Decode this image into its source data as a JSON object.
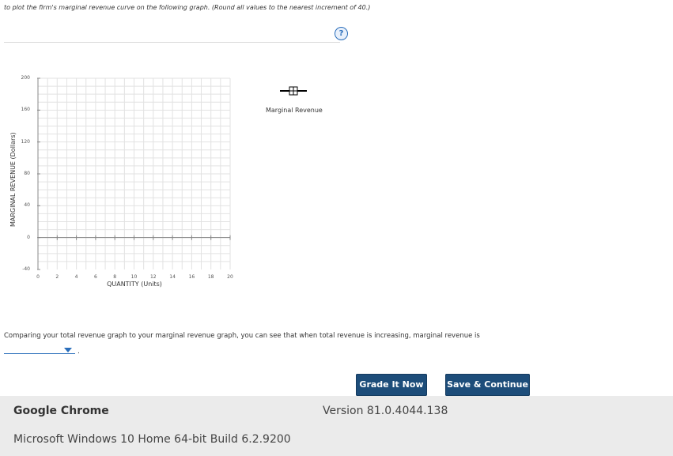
{
  "question": {
    "instruction": "to plot the firm's marginal revenue curve on the following graph. (Round all values to the nearest increment of 40.)",
    "help_label": "?",
    "prompt": "Comparing your total revenue graph to your marginal revenue graph, you can see that when total revenue is increasing, marginal revenue is",
    "dropdown_value": "",
    "period": "."
  },
  "chart_data": {
    "type": "line",
    "ylabel": "MARGINAL REVENUE (Dollars)",
    "xlabel": "QUANTITY (Units)",
    "xlim": [
      0,
      20
    ],
    "ylim": [
      -40,
      200
    ],
    "xticks": [
      0,
      2,
      4,
      6,
      8,
      10,
      12,
      14,
      16,
      18,
      20
    ],
    "yticks": [
      -40,
      0,
      40,
      80,
      120,
      160,
      200
    ],
    "grid": true,
    "series": [
      {
        "name": "Marginal Revenue",
        "values": []
      }
    ],
    "legend_position": "right",
    "colors": {
      "grid": "#e2e2e2",
      "axis": "#888888",
      "marker": "#000000"
    }
  },
  "buttons": {
    "grade": "Grade It Now",
    "save": "Save & Continue"
  },
  "footer": {
    "app": "Google Chrome",
    "version": "Version 81.0.4044.138",
    "os": "Microsoft Windows 10 Home 64-bit Build 6.2.9200"
  },
  "colors": {
    "button_bg": "#1d4d7a",
    "accent": "#2a6ebb",
    "footer_bg": "#ebebeb"
  }
}
